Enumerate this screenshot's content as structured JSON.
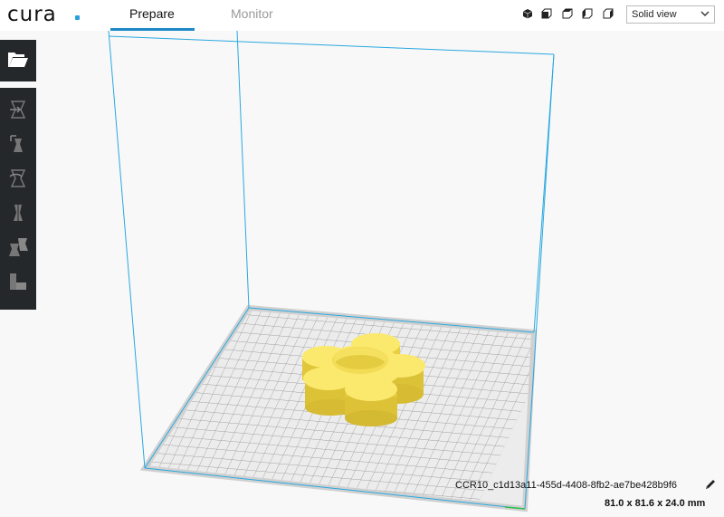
{
  "app": {
    "logo": "cura"
  },
  "tabs": [
    {
      "label": "Prepare",
      "active": true
    },
    {
      "label": "Monitor",
      "active": false
    }
  ],
  "view_controls": {
    "icons": [
      "3d-view-icon",
      "front-view-icon",
      "top-view-icon",
      "left-view-icon",
      "right-view-icon"
    ],
    "selected_view": "Solid view"
  },
  "sidebar": {
    "open_icon": "folder-open-icon",
    "tools": [
      "move-tool-icon",
      "scale-tool-icon",
      "rotate-tool-icon",
      "mirror-tool-icon",
      "per-model-settings-icon",
      "support-blocker-icon"
    ]
  },
  "model": {
    "name": "CCR10_c1d13a11-455d-4408-8fb2-ae7be428b9f6",
    "dimensions": "81.0 x 81.6 x 24.0 mm"
  },
  "colors": {
    "accent": "#1e88c9",
    "model": "#f5e15a",
    "build_volume": "#29a8e0"
  }
}
